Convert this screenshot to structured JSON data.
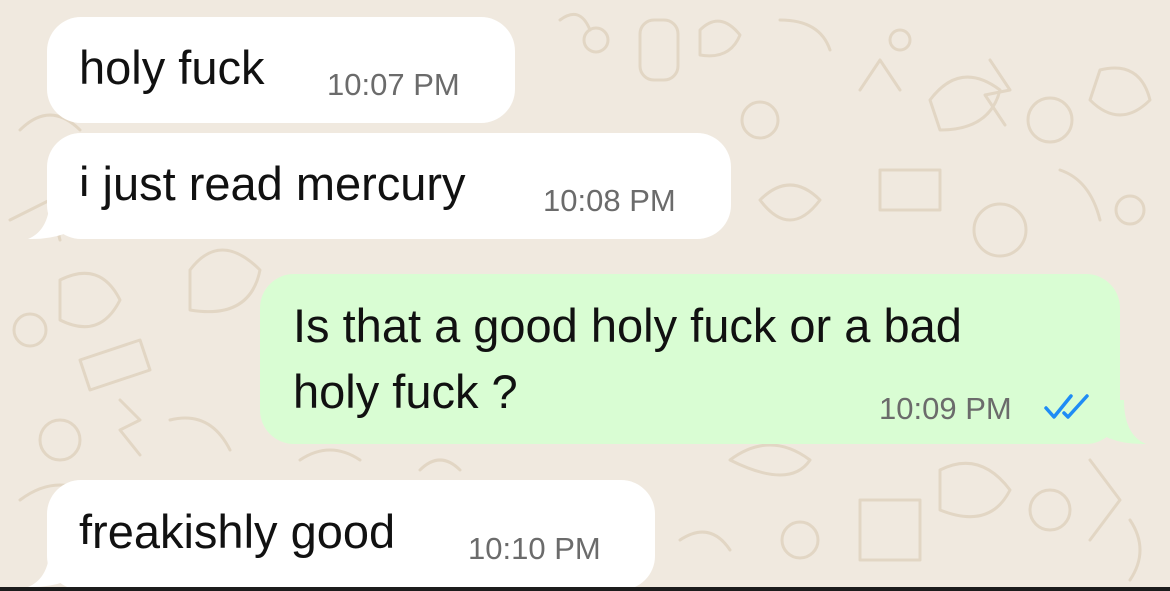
{
  "messages": [
    {
      "direction": "incoming",
      "text": "holy fuck",
      "time": "10:07 PM"
    },
    {
      "direction": "incoming",
      "text": "i just read mercury",
      "time": "10:08 PM"
    },
    {
      "direction": "outgoing",
      "lines": [
        "Is that a good holy fuck or a bad",
        "holy fuck ?"
      ],
      "time": "10:09 PM",
      "status": "read",
      "status_icon": "double-check-icon",
      "status_color": "#1f8cf5"
    },
    {
      "direction": "incoming",
      "text": "freakishly good",
      "time": "10:10 PM"
    }
  ],
  "colors": {
    "wallpaper": "#f0e9df",
    "incoming_bubble": "#ffffff",
    "outgoing_bubble": "#d9fdd3",
    "timestamp": "#6b6b6b",
    "read_ticks": "#1f8cf5"
  }
}
